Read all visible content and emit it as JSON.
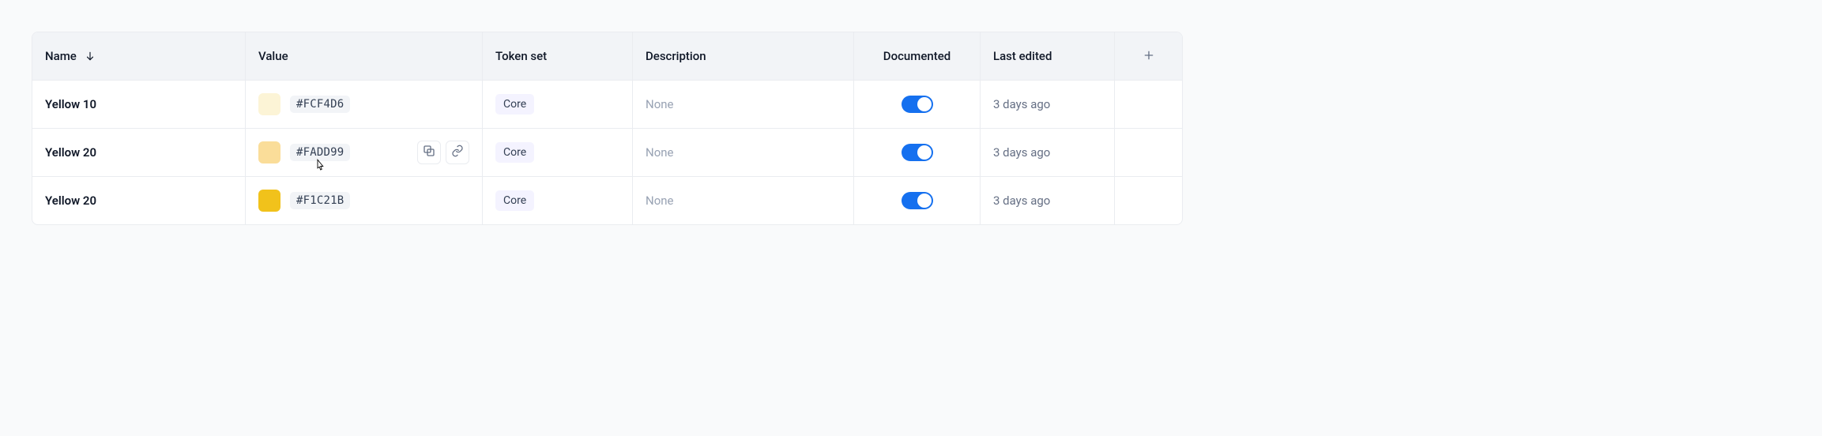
{
  "columns": {
    "name": "Name",
    "value": "Value",
    "token_set": "Token set",
    "description": "Description",
    "documented": "Documented",
    "last_edited": "Last edited"
  },
  "rows": [
    {
      "name": "Yellow 10",
      "swatch": "#FCF4D6",
      "hex": "#FCF4D6",
      "token_set": "Core",
      "description": "None",
      "documented": true,
      "last_edited": "3 days ago",
      "hovered": false
    },
    {
      "name": "Yellow 20",
      "swatch": "#FADD99",
      "hex": "#FADD99",
      "token_set": "Core",
      "description": "None",
      "documented": true,
      "last_edited": "3 days ago",
      "hovered": true
    },
    {
      "name": "Yellow 20",
      "swatch": "#F1C21B",
      "hex": "#F1C21B",
      "token_set": "Core",
      "description": "None",
      "documented": true,
      "last_edited": "3 days ago",
      "hovered": false
    }
  ]
}
